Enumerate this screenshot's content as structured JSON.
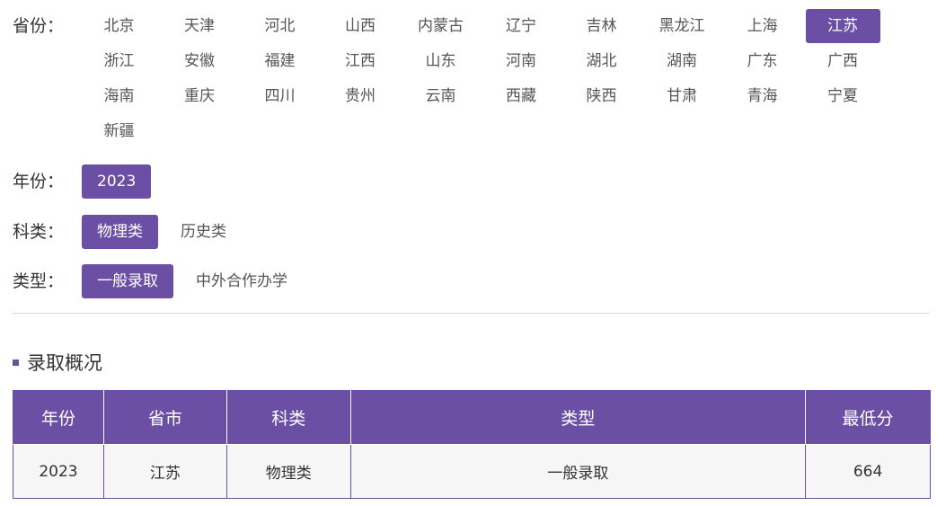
{
  "filters": {
    "province": {
      "label": "省份：",
      "options": [
        "北京",
        "天津",
        "河北",
        "山西",
        "内蒙古",
        "辽宁",
        "吉林",
        "黑龙江",
        "上海",
        "江苏",
        "浙江",
        "安徽",
        "福建",
        "江西",
        "山东",
        "河南",
        "湖北",
        "湖南",
        "广东",
        "广西",
        "海南",
        "重庆",
        "四川",
        "贵州",
        "云南",
        "西藏",
        "陕西",
        "甘肃",
        "青海",
        "宁夏",
        "新疆"
      ],
      "selected": "江苏"
    },
    "year": {
      "label": "年份：",
      "options": [
        "2023"
      ],
      "selected": "2023"
    },
    "category": {
      "label": "科类：",
      "options": [
        "物理类",
        "历史类"
      ],
      "selected": "物理类"
    },
    "type": {
      "label": "类型：",
      "options": [
        "一般录取",
        "中外合作办学"
      ],
      "selected": "一般录取"
    }
  },
  "section": {
    "title": "录取概况"
  },
  "table": {
    "headers": [
      "年份",
      "省市",
      "科类",
      "类型",
      "最低分"
    ],
    "rows": [
      [
        "2023",
        "江苏",
        "物理类",
        "一般录取",
        "664"
      ]
    ]
  },
  "colors": {
    "accent": "#6a4fa5",
    "row_bg": "#f6f6f6",
    "divider": "#d8d8d8"
  }
}
